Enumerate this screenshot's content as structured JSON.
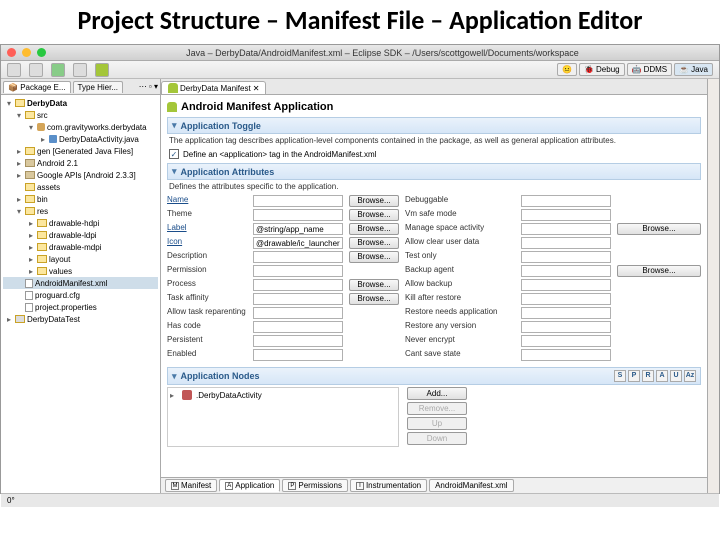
{
  "slide_title": "Project Structure – Manifest File – Application Editor",
  "window": {
    "title": "Java – DerbyData/AndroidManifest.xml – Eclipse SDK – /Users/scottgowell/Documents/workspace"
  },
  "perspectives": [
    {
      "label": "Debug"
    },
    {
      "label": "DDMS"
    },
    {
      "label": "Java"
    }
  ],
  "left_tabs": {
    "a": "Package E...",
    "b": "Type Hier..."
  },
  "project_tree": {
    "project": "DerbyData",
    "src": "src",
    "pkg": "com.gravityworks.derbydata",
    "java": "DerbyDataActivity.java",
    "gen": "gen [Generated Java Files]",
    "android_lib": "Android 2.1",
    "google_lib": "Google APIs [Android 2.3.3]",
    "assets": "assets",
    "bin": "bin",
    "res": "res",
    "drawable_hdpi": "drawable-hdpi",
    "drawable_ldpi": "drawable-ldpi",
    "drawable_mdpi": "drawable-mdpi",
    "layout": "layout",
    "values": "values",
    "manifest": "AndroidManifest.xml",
    "proguard": "proguard.cfg",
    "project_props": "project.properties",
    "closed": "DerbyDataTest"
  },
  "editor": {
    "tab": "DerbyData Manifest",
    "title": "Android Manifest Application",
    "sect_toggle": "Application Toggle",
    "toggle_desc": "The application tag describes application-level components contained in the package, as well as general application attributes.",
    "toggle_check": "Define an <application> tag in the AndroidManifest.xml",
    "sect_attrs": "Application Attributes",
    "attrs_desc": "Defines the attributes specific to the application.",
    "rows": [
      {
        "l": "Name",
        "v": "",
        "b": true,
        "r": "Debuggable",
        "rv": "",
        "rb": false
      },
      {
        "l": "Theme",
        "v": "",
        "b": true,
        "r": "Vm safe mode",
        "rv": "",
        "rb": false
      },
      {
        "l": "Label",
        "v": "@string/app_name",
        "b": true,
        "r": "Manage space activity",
        "rv": "",
        "rb": true
      },
      {
        "l": "Icon",
        "v": "@drawable/ic_launcher",
        "b": true,
        "r": "Allow clear user data",
        "rv": "",
        "rb": false
      },
      {
        "l": "Description",
        "v": "",
        "b": true,
        "r": "Test only",
        "rv": "",
        "rb": false
      },
      {
        "l": "Permission",
        "v": "",
        "b": false,
        "r": "Backup agent",
        "rv": "",
        "rb": true
      },
      {
        "l": "Process",
        "v": "",
        "b": true,
        "r": "Allow backup",
        "rv": "",
        "rb": false
      },
      {
        "l": "Task affinity",
        "v": "",
        "b": true,
        "r": "Kill after restore",
        "rv": "",
        "rb": false
      },
      {
        "l": "Allow task reparenting",
        "v": "",
        "b": false,
        "r": "Restore needs application",
        "rv": "",
        "rb": false
      },
      {
        "l": "Has code",
        "v": "",
        "b": false,
        "r": "Restore any version",
        "rv": "",
        "rb": false
      },
      {
        "l": "Persistent",
        "v": "",
        "b": false,
        "r": "Never encrypt",
        "rv": "",
        "rb": false
      },
      {
        "l": "Enabled",
        "v": "",
        "b": false,
        "r": "Cant save state",
        "rv": "",
        "rb": false
      }
    ],
    "sect_nodes": "Application Nodes",
    "node_filters": [
      "S",
      "P",
      "R",
      "A",
      "U",
      "Az"
    ],
    "node_item": ".DerbyDataActivity",
    "node_btns": {
      "add": "Add...",
      "remove": "Remove...",
      "up": "Up",
      "down": "Down"
    },
    "browse": "Browse..."
  },
  "bottom_tabs": [
    {
      "ic": "M",
      "label": "Manifest"
    },
    {
      "ic": "A",
      "label": "Application"
    },
    {
      "ic": "P",
      "label": "Permissions"
    },
    {
      "ic": "I",
      "label": "Instrumentation"
    },
    {
      "ic": "",
      "label": "AndroidManifest.xml"
    }
  ],
  "status": "0°"
}
